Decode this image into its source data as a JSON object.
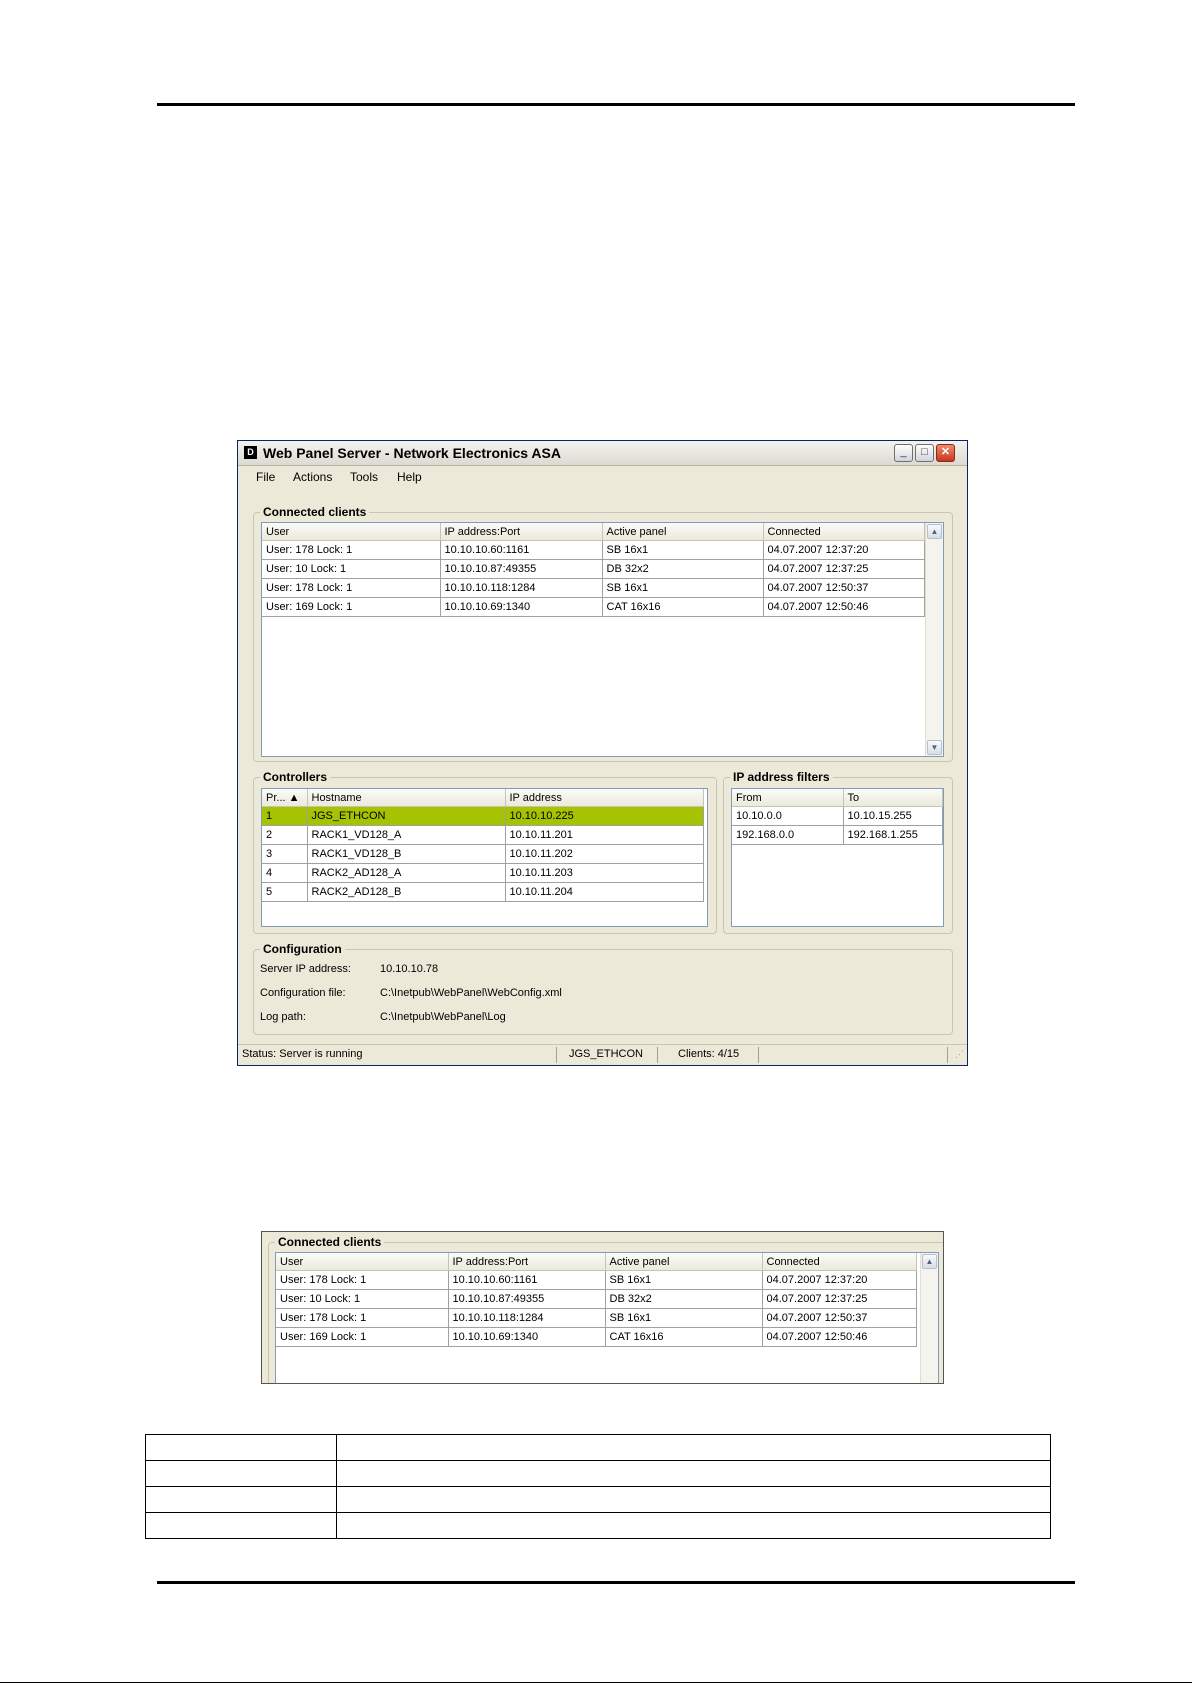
{
  "window": {
    "icon_glyph": "D",
    "title": "Web Panel Server - Network Electronics ASA",
    "controls": {
      "minimize": "_",
      "maximize": "□",
      "close": "✕"
    }
  },
  "menu": [
    "File",
    "Actions",
    "Tools",
    "Help"
  ],
  "clients": {
    "label": "Connected clients",
    "columns": [
      "User",
      "IP address:Port",
      "Active panel",
      "Connected"
    ],
    "rows": [
      [
        "User: 178 Lock: 1",
        "10.10.10.60:1161",
        "SB 16x1",
        "04.07.2007 12:37:20"
      ],
      [
        "User: 10 Lock: 1",
        "10.10.10.87:49355",
        "DB 32x2",
        "04.07.2007 12:37:25"
      ],
      [
        "User: 178 Lock: 1",
        "10.10.10.118:1284",
        "SB 16x1",
        "04.07.2007 12:50:37"
      ],
      [
        "User: 169 Lock: 1",
        "10.10.10.69:1340",
        "CAT 16x16",
        "04.07.2007 12:50:46"
      ]
    ]
  },
  "controllers": {
    "label": "Controllers",
    "columns": [
      "Pr... ▲",
      "Hostname",
      "IP address"
    ],
    "rows": [
      [
        "1",
        "JGS_ETHCON",
        "10.10.10.225"
      ],
      [
        "2",
        "RACK1_VD128_A",
        "10.10.11.201"
      ],
      [
        "3",
        "RACK1_VD128_B",
        "10.10.11.202"
      ],
      [
        "4",
        "RACK2_AD128_A",
        "10.10.11.203"
      ],
      [
        "5",
        "RACK2_AD128_B",
        "10.10.11.204"
      ]
    ]
  },
  "filters": {
    "label": "IP address filters",
    "columns": [
      "From",
      "To"
    ],
    "rows": [
      [
        "10.10.0.0",
        "10.10.15.255"
      ],
      [
        "192.168.0.0",
        "192.168.1.255"
      ]
    ]
  },
  "configuration": {
    "label": "Configuration",
    "server_ip_label": "Server IP address:",
    "server_ip": "10.10.10.78",
    "config_file_label": "Configuration file:",
    "config_file": "C:\\Inetpub\\WebPanel\\WebConfig.xml",
    "log_path_label": "Log path:",
    "log_path": "C:\\Inetpub\\WebPanel\\Log"
  },
  "status": {
    "text": "Status: Server is running",
    "controller": "JGS_ETHCON",
    "clients": "Clients: 4/15"
  },
  "colors": {
    "selected_row": "#a5c300",
    "window_bg": "#ece9d8"
  }
}
